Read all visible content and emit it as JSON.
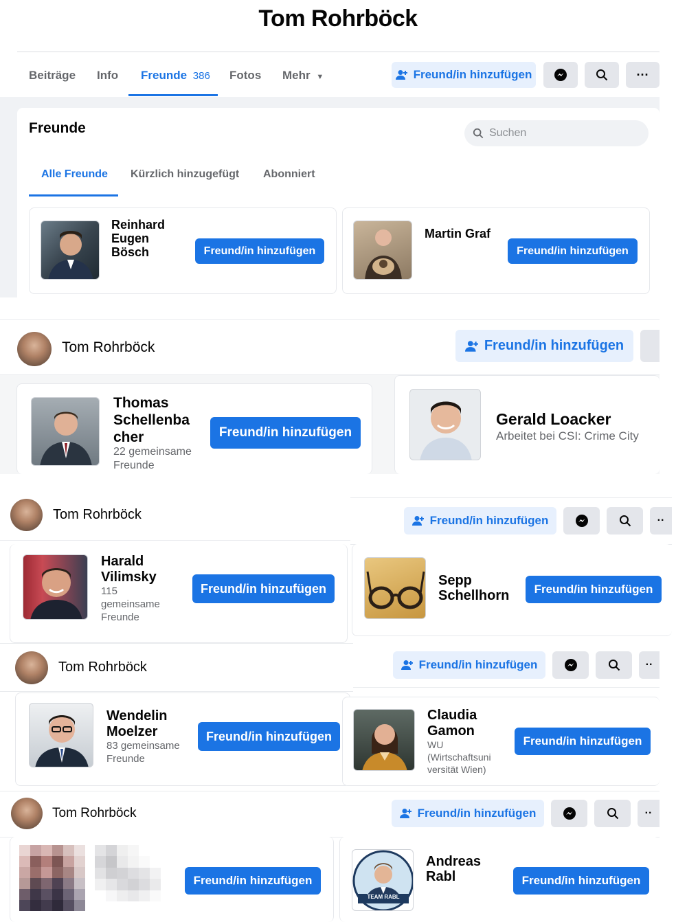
{
  "page_title": "Tom Rohrböck",
  "profile_name": "Tom Rohrböck",
  "nav": {
    "tabs": [
      "Beiträge",
      "Info",
      "Freunde",
      "Fotos",
      "Mehr"
    ],
    "friends_count": "386",
    "add_friend": "Freund/in hinzufügen"
  },
  "friends_section": {
    "heading": "Freunde",
    "search_placeholder": "Suchen",
    "subtabs": [
      "Alle Freunde",
      "Kürzlich hinzugefügt",
      "Abonniert"
    ]
  },
  "add_friend_label": "Freund/in hinzufügen",
  "friends": [
    {
      "name": "Reinhard Eugen Bösch",
      "lines": [
        "Reinhard",
        "Eugen",
        "Bösch"
      ]
    },
    {
      "name": "Martin Graf",
      "lines": [
        "Martin Graf"
      ]
    },
    {
      "name": "Thomas Schellenbacher",
      "lines": [
        "Thomas",
        "Schellenba",
        "cher"
      ],
      "sub": [
        "22 gemeinsame",
        "Freunde"
      ]
    },
    {
      "name": "Gerald Loacker",
      "lines": [
        "Gerald Loacker"
      ],
      "sub": [
        "Arbeitet bei CSI: Crime City"
      ]
    },
    {
      "name": "Harald Vilimsky",
      "lines": [
        "Harald",
        "Vilimsky"
      ],
      "sub": [
        "115",
        "gemeinsame",
        "Freunde"
      ]
    },
    {
      "name": "Sepp Schellhorn",
      "lines": [
        "Sepp",
        "Schellhorn"
      ]
    },
    {
      "name": "Wendelin Moelzer",
      "lines": [
        "Wendelin",
        "Moelzer"
      ],
      "sub": [
        "83 gemeinsame",
        "Freunde"
      ]
    },
    {
      "name": "Claudia Gamon",
      "lines": [
        "Claudia",
        "Gamon"
      ],
      "sub": [
        "WU",
        "(Wirtschaftsuni",
        "versität Wien)"
      ]
    },
    {
      "name": "Andreas Rabl",
      "lines": [
        "Andreas",
        "Rabl"
      ],
      "badge": "TEAM RABL"
    }
  ],
  "colors": {
    "accent": "#1b74e4",
    "accent_light": "#e7f0fd",
    "gray_button": "#e4e6eb",
    "background": "#f0f2f5"
  }
}
